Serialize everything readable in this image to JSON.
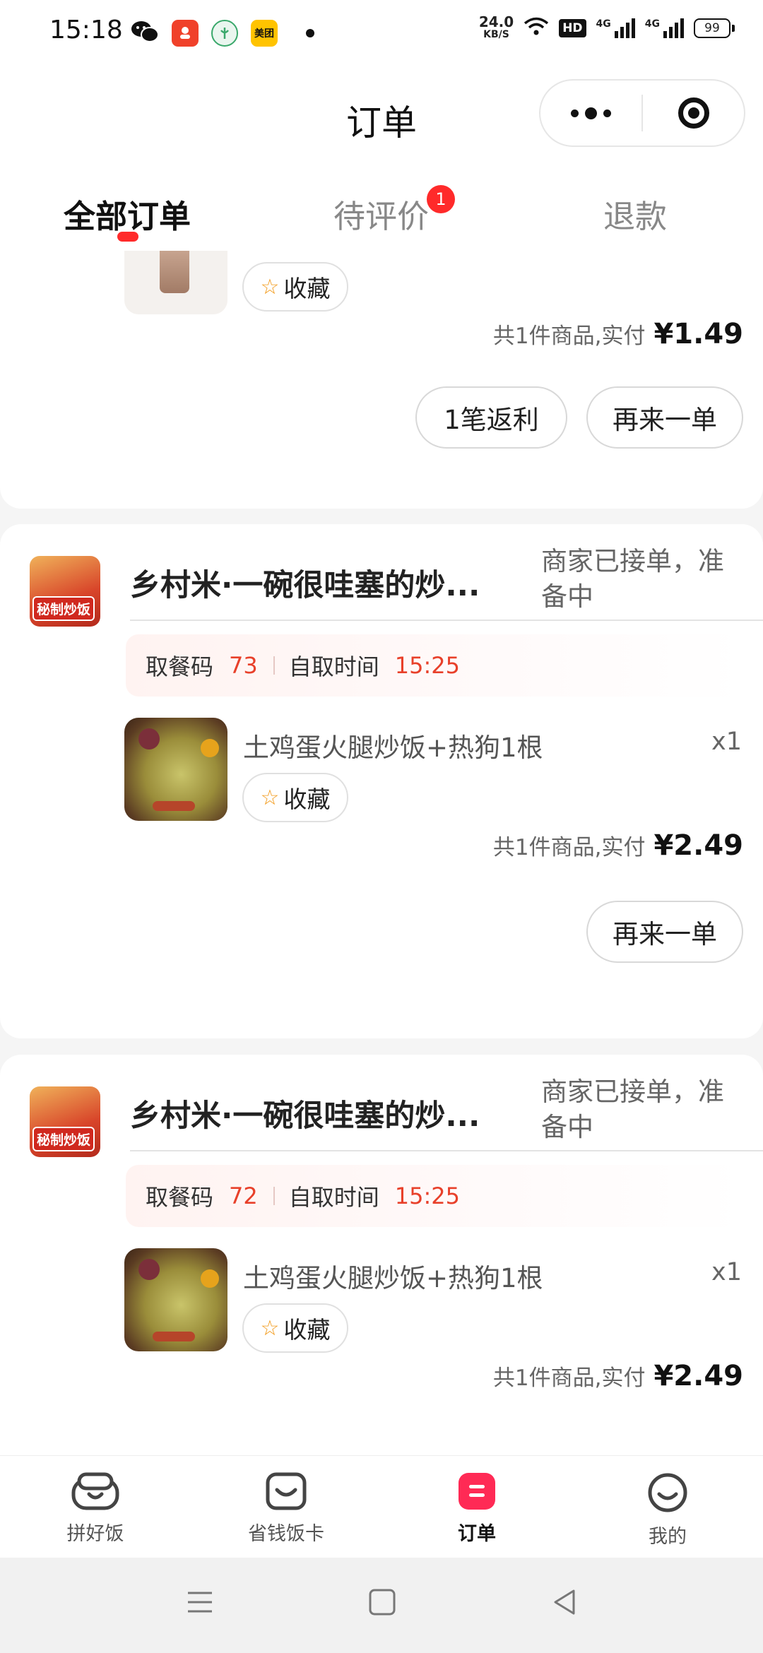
{
  "status_bar": {
    "time": "15:18",
    "apps": [
      {
        "icon": "wechat-icon",
        "label": ""
      },
      {
        "icon": "pinduoduo-icon",
        "label": "",
        "color": "#f0412a"
      },
      {
        "icon": "app-green-icon",
        "label": "",
        "color": "#3aa86b"
      },
      {
        "icon": "meituan-icon",
        "label": "美团",
        "color": "#ffc300"
      }
    ],
    "net_speed": "24.0",
    "net_unit": "KB/S",
    "hd_label": "HD",
    "net1_label": "4G",
    "net2_label": "4G",
    "battery": "99"
  },
  "header": {
    "title": "订单",
    "menu_icon": "more-dots-icon",
    "close_icon": "target-close-icon"
  },
  "tabs": [
    {
      "label": "全部订单",
      "active": true
    },
    {
      "label": "待评价",
      "badge": "1"
    },
    {
      "label": "退款"
    }
  ],
  "accent_color": "#ff2a2a",
  "orders": [
    {
      "favorite_label": "收藏",
      "total_label": "共1件商品,实付",
      "total_amount": "¥1.49",
      "buttons": [
        "1笔返利",
        "再来一单"
      ]
    },
    {
      "shop_name": "乡村米·一碗很哇塞的炒...",
      "logo_text": "秘制炒饭",
      "status": "商家已接单，准备中",
      "pickup_code_label": "取餐码",
      "pickup_code": "73",
      "pickup_time_label": "自取时间",
      "pickup_time": "15:25",
      "item_name": "土鸡蛋火腿炒饭+热狗1根",
      "item_qty": "x1",
      "favorite_label": "收藏",
      "total_label": "共1件商品,实付",
      "total_amount": "¥2.49",
      "buttons": [
        "再来一单"
      ]
    },
    {
      "shop_name": "乡村米·一碗很哇塞的炒...",
      "logo_text": "秘制炒饭",
      "status": "商家已接单，准备中",
      "pickup_code_label": "取餐码",
      "pickup_code": "72",
      "pickup_time_label": "自取时间",
      "pickup_time": "15:25",
      "item_name": "土鸡蛋火腿炒饭+热狗1根",
      "item_qty": "x1",
      "favorite_label": "收藏",
      "total_label": "共1件商品,实付",
      "total_amount": "¥2.49"
    }
  ],
  "bottom_nav": [
    {
      "label": "拼好饭",
      "icon": "pinhaofan-icon"
    },
    {
      "label": "省钱饭卡",
      "icon": "savings-card-icon"
    },
    {
      "label": "订单",
      "icon": "orders-icon",
      "active": true
    },
    {
      "label": "我的",
      "icon": "profile-icon"
    }
  ],
  "system_nav": [
    "menu-lines-icon",
    "home-square-icon",
    "back-triangle-icon"
  ]
}
